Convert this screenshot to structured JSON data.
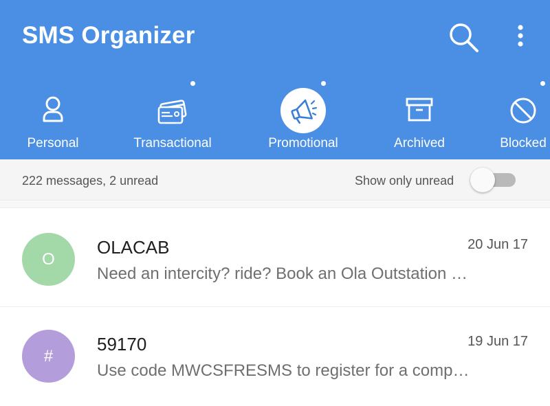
{
  "app": {
    "title": "SMS Organizer",
    "accent": "#4a8fe3",
    "actions": [
      {
        "name": "search",
        "icon": "search-icon"
      },
      {
        "name": "more",
        "icon": "more-vert-icon"
      }
    ]
  },
  "tabs": [
    {
      "label": "Personal",
      "icon": "person-icon",
      "selected": false,
      "unread_dot": false
    },
    {
      "label": "Transactional",
      "icon": "card-icon",
      "selected": false,
      "unread_dot": true
    },
    {
      "label": "Promotional",
      "icon": "megaphone-icon",
      "selected": true,
      "unread_dot": true
    },
    {
      "label": "Archived",
      "icon": "archive-box-icon",
      "selected": false,
      "unread_dot": false
    },
    {
      "label": "Blocked",
      "icon": "block-icon",
      "selected": false,
      "unread_dot": true
    }
  ],
  "summary": {
    "text": "222 messages, 2 unread",
    "toggle_label": "Show only unread",
    "toggle_on": false
  },
  "messages": [
    {
      "avatar_letter": "O",
      "avatar_color": "#a3d9a8",
      "sender": "OLACAB",
      "date": "20 Jun 17",
      "preview": "Need an intercity? ride? Book an Ola Outstation …"
    },
    {
      "avatar_letter": "#",
      "avatar_color": "#b39ddb",
      "sender": "59170",
      "date": "19 Jun 17",
      "preview": "Use code MWCSFRESMS to register for a comp…"
    }
  ]
}
